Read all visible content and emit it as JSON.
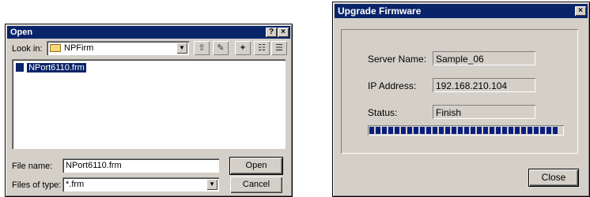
{
  "open_dialog": {
    "title": "Open",
    "help_btn": "?",
    "close_btn": "×",
    "look_in_label": "Look in:",
    "look_in_value": "NPFirm",
    "file_item": "NPort6110.frm",
    "file_name_label": "File name:",
    "file_name_value": "NPort6110.frm",
    "files_of_type_label": "Files of type:",
    "files_of_type_value": "*.frm",
    "open_button": "Open",
    "cancel_button": "Cancel"
  },
  "upgrade_dialog": {
    "title": "Upgrade Firmware",
    "close_btn": "×",
    "server_name_label": "Server Name:",
    "server_name_value": "Sample_06",
    "ip_address_label": "IP Address:",
    "ip_address_value": "192.168.210.104",
    "status_label": "Status:",
    "status_value": "Finish",
    "progress": 1.0,
    "close_button": "Close"
  }
}
